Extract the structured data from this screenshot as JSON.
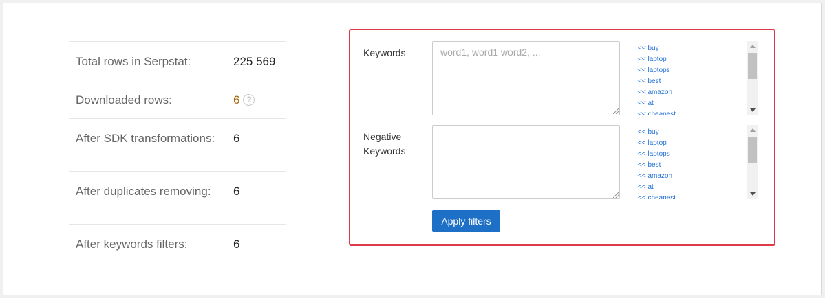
{
  "stats": [
    {
      "label": "Total rows in Serpstat:",
      "value": "225 569"
    },
    {
      "label": "Downloaded rows:",
      "value": "6",
      "help": "?"
    },
    {
      "label": "After SDK transformations:",
      "value": "6"
    },
    {
      "label": "After duplicates removing:",
      "value": "6"
    },
    {
      "label": "After keywords filters:",
      "value": "6"
    }
  ],
  "filters": {
    "keywords_label": "Keywords",
    "keywords_placeholder": "word1, word1 word2, ...",
    "negative_label_line1": "Negative",
    "negative_label_line2": "Keywords",
    "negative_placeholder": "",
    "suggestions_keywords": [
      "<< buy",
      "<< laptop",
      "<< laptops",
      "<< best",
      "<< amazon",
      "<< at",
      "<< cheapest"
    ],
    "suggestions_negative": [
      "<< buy",
      "<< laptop",
      "<< laptops",
      "<< best",
      "<< amazon",
      "<< at",
      "<< cheapest"
    ],
    "apply_label": "Apply filters"
  },
  "colors": {
    "panel_border": "#e03a4a",
    "button": "#1e6fc6",
    "link": "#1f6fd6",
    "highlight_value": "#a5690a"
  }
}
